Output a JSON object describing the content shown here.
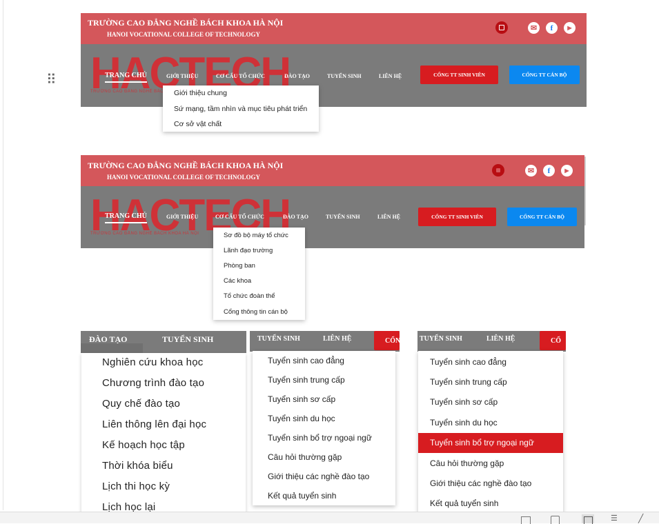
{
  "header": {
    "title_vn": "TRƯỜNG CAO ĐẲNG NGHỀ BÁCH KHOA HÀ NỘI",
    "title_en": "HANOI VOCATIONAL COLLEGE OF TECHNOLOGY",
    "logo": "HACTECH",
    "logo_sub": "TRƯỜNG CAO ĐẲNG NGHỀ BÁCH KHOA HÀ NỘI",
    "icons": [
      "app-icon",
      "mail-icon",
      "facebook-icon",
      "youtube-icon"
    ]
  },
  "nav": {
    "home": "TRANG CHỦ",
    "about": "GIỚI THIỆU",
    "structure": "CƠ CẤU TỔ CHỨC",
    "training": "ĐÀO TẠO",
    "admissions": "TUYỂN SINH",
    "contact": "LIÊN HỆ",
    "student_portal": "CỔNG TT SINH VIÊN",
    "staff_portal": "CỔNG TT CÁN BỘ",
    "student_portal_cut": "CỔN",
    "student_portal_cut2": "CỔ"
  },
  "dropdown_about": {
    "items": [
      "Giới thiệu chung",
      "Sứ mạng, tầm nhìn và mục tiêu phát triển",
      "Cơ sở vật chất"
    ]
  },
  "dropdown_structure": {
    "items": [
      "Sơ đồ bộ máy tổ chức",
      "Lãnh đạo trường",
      "Phòng ban",
      "Các khoa",
      "Tổ chức đoàn thể",
      "Cổng thông tin cán bộ"
    ]
  },
  "dropdown_training": {
    "items": [
      "Nghiên cứu khoa học",
      "Chương trình đào tạo",
      "Quy chế đào tạo",
      "Liên thông lên đại học",
      "Kế hoạch học tập",
      "Thời khóa biểu",
      "Lịch thi học kỳ",
      "Lịch học lại"
    ]
  },
  "dropdown_admissions": {
    "items": [
      "Tuyển sinh cao đẳng",
      "Tuyển sinh trung cấp",
      "Tuyển sinh sơ cấp",
      "Tuyển sinh du học",
      "Tuyển sinh bổ trợ ngoại ngữ",
      "Câu hỏi thường gặp",
      "Giới thiệu các nghề đào tạo",
      "Kết quả tuyển sinh"
    ],
    "highlighted_index": 4
  },
  "colors": {
    "topbar": "#d4575b",
    "navbar": "#7b7b7b",
    "red_button": "#d71c20",
    "blue_button": "#0b88f0",
    "highlight": "#d71c20"
  }
}
